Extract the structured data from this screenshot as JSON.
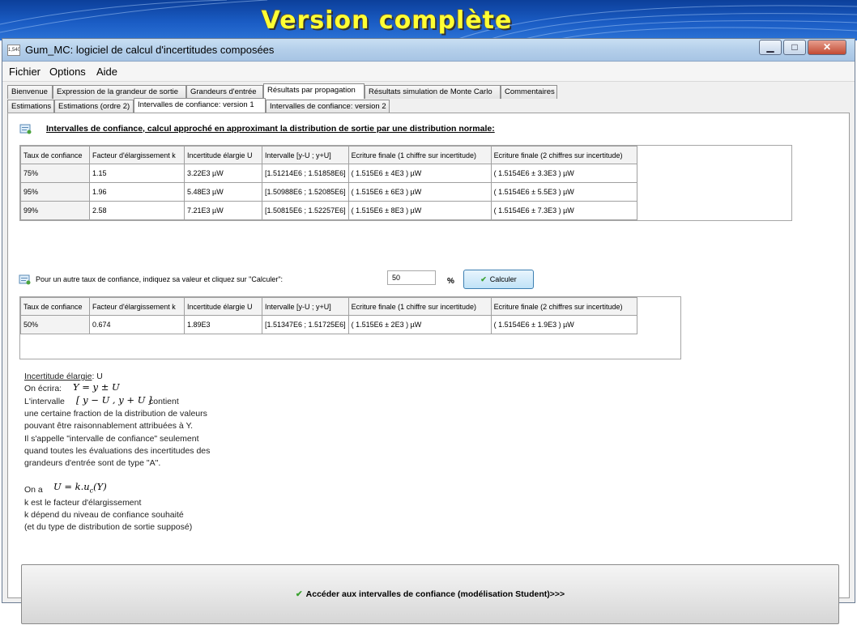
{
  "slide": {
    "title": "Version complète"
  },
  "window": {
    "icon_text": "1,540,1",
    "title": "Gum_MC: logiciel de calcul d'incertitudes composées",
    "controls": {
      "minimize": "▁",
      "maximize": "□",
      "close": "✕"
    }
  },
  "menu": {
    "items": [
      "Fichier",
      "Options",
      "Aide"
    ]
  },
  "main_tabs": [
    {
      "label": "Bienvenue"
    },
    {
      "label": "Expression de la grandeur de sortie"
    },
    {
      "label": "Grandeurs d'entrée"
    },
    {
      "label": "Résultats par propagation"
    },
    {
      "label": "Résultats simulation de Monte Carlo"
    },
    {
      "label": "Commentaires"
    }
  ],
  "sub_tabs": [
    {
      "label": "Estimations"
    },
    {
      "label": "Estimations (ordre 2)"
    },
    {
      "label": "Intervalles de confiance: version 1"
    },
    {
      "label": "Intervalles de confiance: version 2"
    }
  ],
  "heading": "Intervalles de confiance, calcul approché en approximant la distribution de sortie par une distribution normale:",
  "table": {
    "headers": [
      "Taux de confiance",
      "Facteur d'élargissement k",
      "Incertitude élargie U",
      "Intervalle [y-U ; y+U]",
      "Ecriture finale (1 chiffre sur incertitude)",
      "Ecriture finale (2 chiffres sur incertitude)"
    ],
    "rows": [
      [
        "75%",
        "1.15",
        "3.22E3 µW",
        "[1.51214E6 ; 1.51858E6]",
        "( 1.515E6 ± 4E3 ) µW",
        "( 1.5154E6 ± 3.3E3 ) µW"
      ],
      [
        "95%",
        "1.96",
        "5.48E3 µW",
        "[1.50988E6 ; 1.52085E6]",
        "( 1.515E6 ± 6E3 ) µW",
        "( 1.5154E6 ± 5.5E3 ) µW"
      ],
      [
        "99%",
        "2.58",
        "7.21E3 µW",
        "[1.50815E6 ; 1.52257E6]",
        "( 1.515E6 ± 8E3 ) µW",
        "( 1.5154E6 ± 7.3E3 ) µW"
      ]
    ]
  },
  "custom": {
    "prompt": "Pour un autre taux de confiance, indiquez sa valeur et cliquez sur \"Calculer\":",
    "input_value": "50",
    "unit": "%",
    "button_label": "Calculer"
  },
  "custom_table": {
    "headers": [
      "Taux de confiance",
      "Facteur d'élargissement k",
      "Incertitude élargie U",
      "Intervalle [y-U ; y+U]",
      "Ecriture finale (1 chiffre sur incertitude)",
      "Ecriture finale (2 chiffres sur incertitude)"
    ],
    "rows": [
      [
        "50%",
        "0.674",
        "1.89E3",
        "[1.51347E6 ; 1.51725E6]",
        "( 1.515E6 ± 2E3 ) µW",
        "( 1.5154E6 ± 1.9E3 ) µW"
      ]
    ]
  },
  "explanation": {
    "title": "Incertitude élargie",
    "title_suffix": ": U",
    "on_ecrira": "On écrira:",
    "formula1": "Y = y ± U",
    "interval_label": "L'intervalle",
    "formula2": "[ y − U , y + U ]",
    "contient": "contient",
    "lines": [
      "une certaine fraction de la distribution de valeurs",
      "pouvant être raisonnablement attribuées à Y.",
      "Il s'appelle \"intervalle de confiance\" seulement",
      "quand toutes les évaluations des incertitudes des",
      "grandeurs d'entrée sont de type \"A\"."
    ],
    "on_a": "On a",
    "formula3": "U = k.u",
    "formula3_sub": "c",
    "formula3_tail": "(Y)",
    "lines2": [
      "k est le facteur d'élargissement",
      "k dépend du niveau de confiance souhaité",
      "(et du type de distribution de sortie supposé)"
    ]
  },
  "big_button": {
    "label": "Accéder aux intervalles de confiance (modélisation Student)>>>"
  },
  "colors": {
    "banner": "#1a5cc4",
    "banner_title": "#ffff33",
    "titlebar": "#b4cfea",
    "check": "#3aa12f"
  }
}
